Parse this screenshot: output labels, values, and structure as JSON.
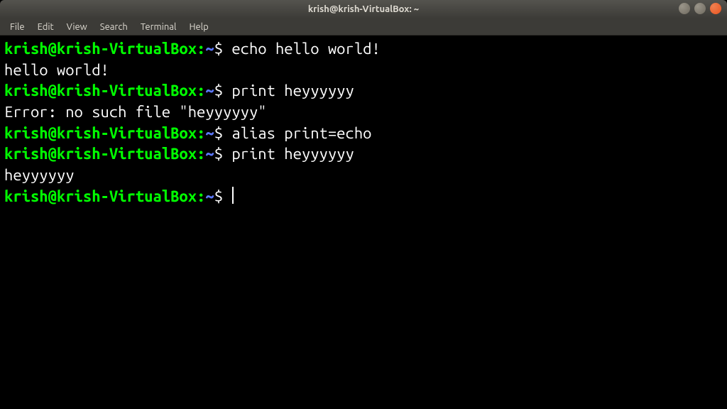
{
  "window": {
    "title": "krish@krish-VirtualBox: ~"
  },
  "menubar": {
    "items": [
      "File",
      "Edit",
      "View",
      "Search",
      "Terminal",
      "Help"
    ]
  },
  "prompt": {
    "userhost": "krish@krish-VirtualBox",
    "colon": ":",
    "path": "~",
    "dollar": "$"
  },
  "lines": [
    {
      "type": "prompt",
      "command": "echo hello world!"
    },
    {
      "type": "output",
      "text": "hello world!"
    },
    {
      "type": "prompt",
      "command": "print heyyyyyy"
    },
    {
      "type": "output",
      "text": "Error: no such file \"heyyyyyy\""
    },
    {
      "type": "prompt",
      "command": "alias print=echo"
    },
    {
      "type": "prompt",
      "command": "print heyyyyyy"
    },
    {
      "type": "output",
      "text": "heyyyyyy"
    },
    {
      "type": "prompt",
      "command": "",
      "cursor": true
    }
  ]
}
